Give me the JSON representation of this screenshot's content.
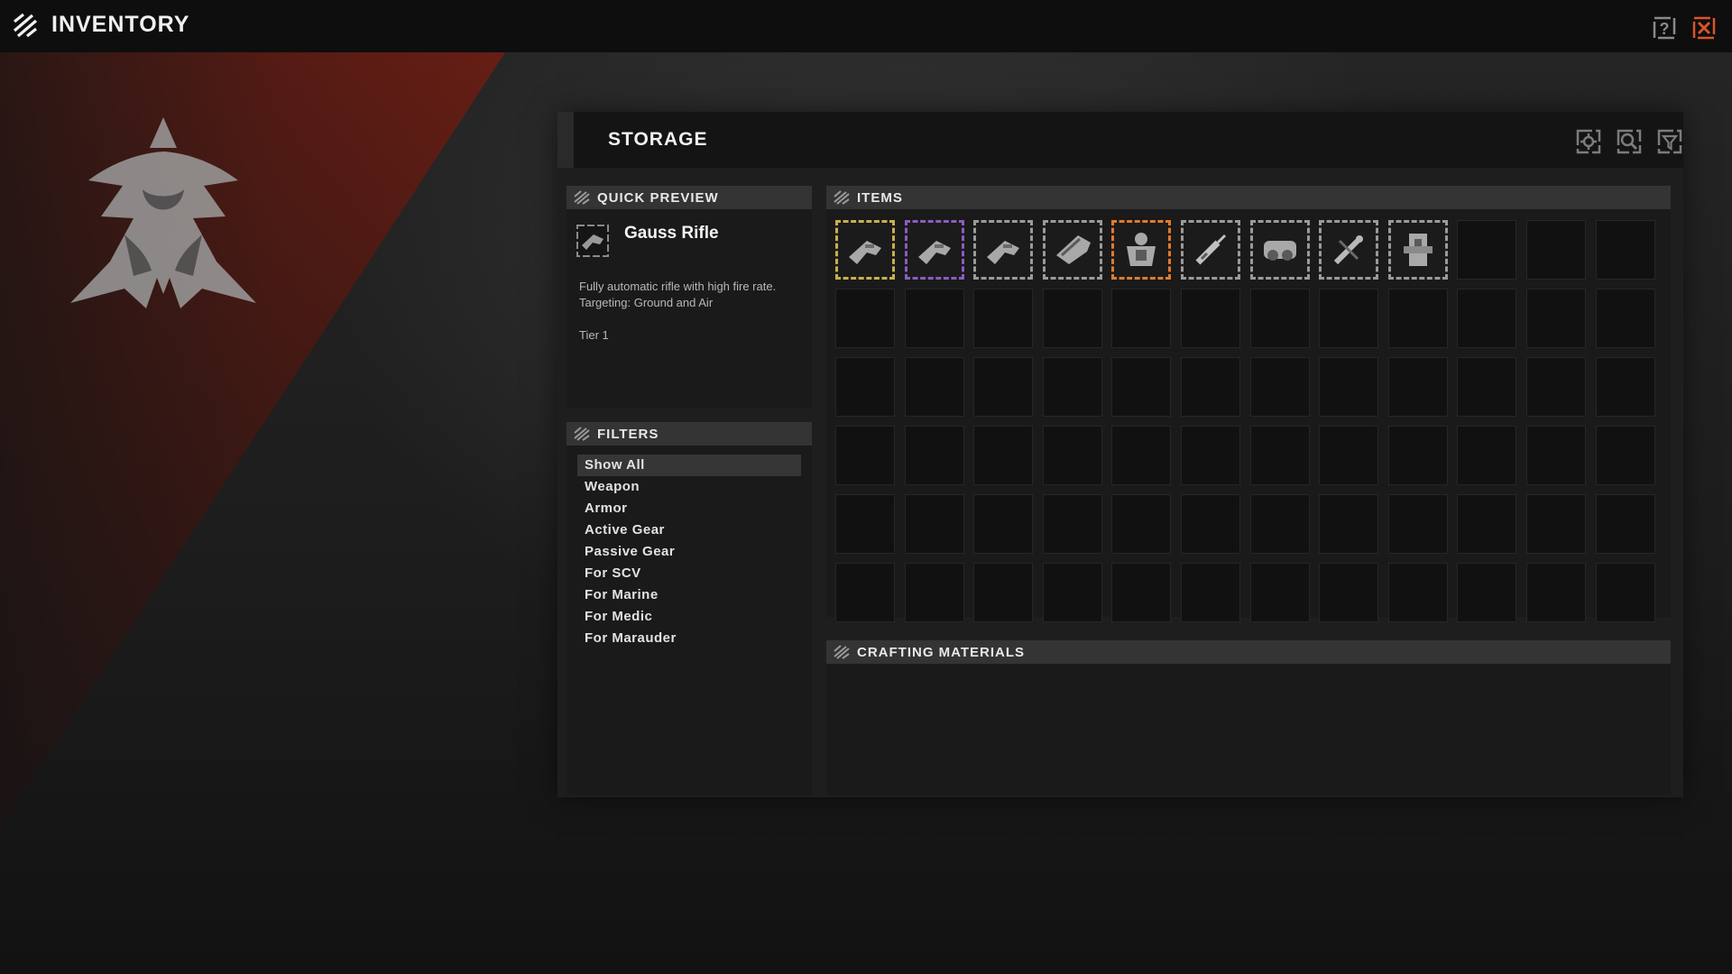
{
  "app": {
    "title": "INVENTORY"
  },
  "storage": {
    "title": "STORAGE"
  },
  "quick_preview": {
    "heading": "QUICK PREVIEW",
    "item_name": "Gauss Rifle",
    "description_line1": "Fully automatic rifle with high fire rate.",
    "description_line2": "Targeting: Ground and Air",
    "tier": "Tier 1"
  },
  "filters": {
    "heading": "FILTERS",
    "items": [
      {
        "label": "Show All",
        "active": true
      },
      {
        "label": "Weapon",
        "active": false
      },
      {
        "label": "Armor",
        "active": false
      },
      {
        "label": "Active Gear",
        "active": false
      },
      {
        "label": "Passive Gear",
        "active": false
      },
      {
        "label": "For SCV",
        "active": false
      },
      {
        "label": "For Marine",
        "active": false
      },
      {
        "label": "For Medic",
        "active": false
      },
      {
        "label": "For Marauder",
        "active": false
      }
    ]
  },
  "items_panel": {
    "heading": "ITEMS",
    "slot_count": 72,
    "filled_items": [
      {
        "icon": "rifle-icon",
        "rarity_color": "#c9b04a"
      },
      {
        "icon": "rifle-icon",
        "rarity_color": "#8a5cc0"
      },
      {
        "icon": "rifle-icon",
        "rarity_color": "#9a9a9a"
      },
      {
        "icon": "launcher-icon",
        "rarity_color": "#9a9a9a"
      },
      {
        "icon": "armor-icon",
        "rarity_color": "#e07a2c"
      },
      {
        "icon": "syringe-icon",
        "rarity_color": "#9a9a9a"
      },
      {
        "icon": "canister-icon",
        "rarity_color": "#9a9a9a"
      },
      {
        "icon": "injector-icon",
        "rarity_color": "#9a9a9a"
      },
      {
        "icon": "device-icon",
        "rarity_color": "#9a9a9a"
      }
    ]
  },
  "crafting": {
    "heading": "CRAFTING MATERIALS"
  },
  "icons": {
    "app_logo": "faction-logo-icon",
    "help": "help-icon",
    "close": "close-icon",
    "settings": "settings-icon",
    "search": "search-icon",
    "filter": "filter-icon",
    "emblem": "terran-emblem-icon"
  },
  "colors": {
    "accent_close": "#d9542b",
    "wedge_red": "#6e1d12"
  }
}
